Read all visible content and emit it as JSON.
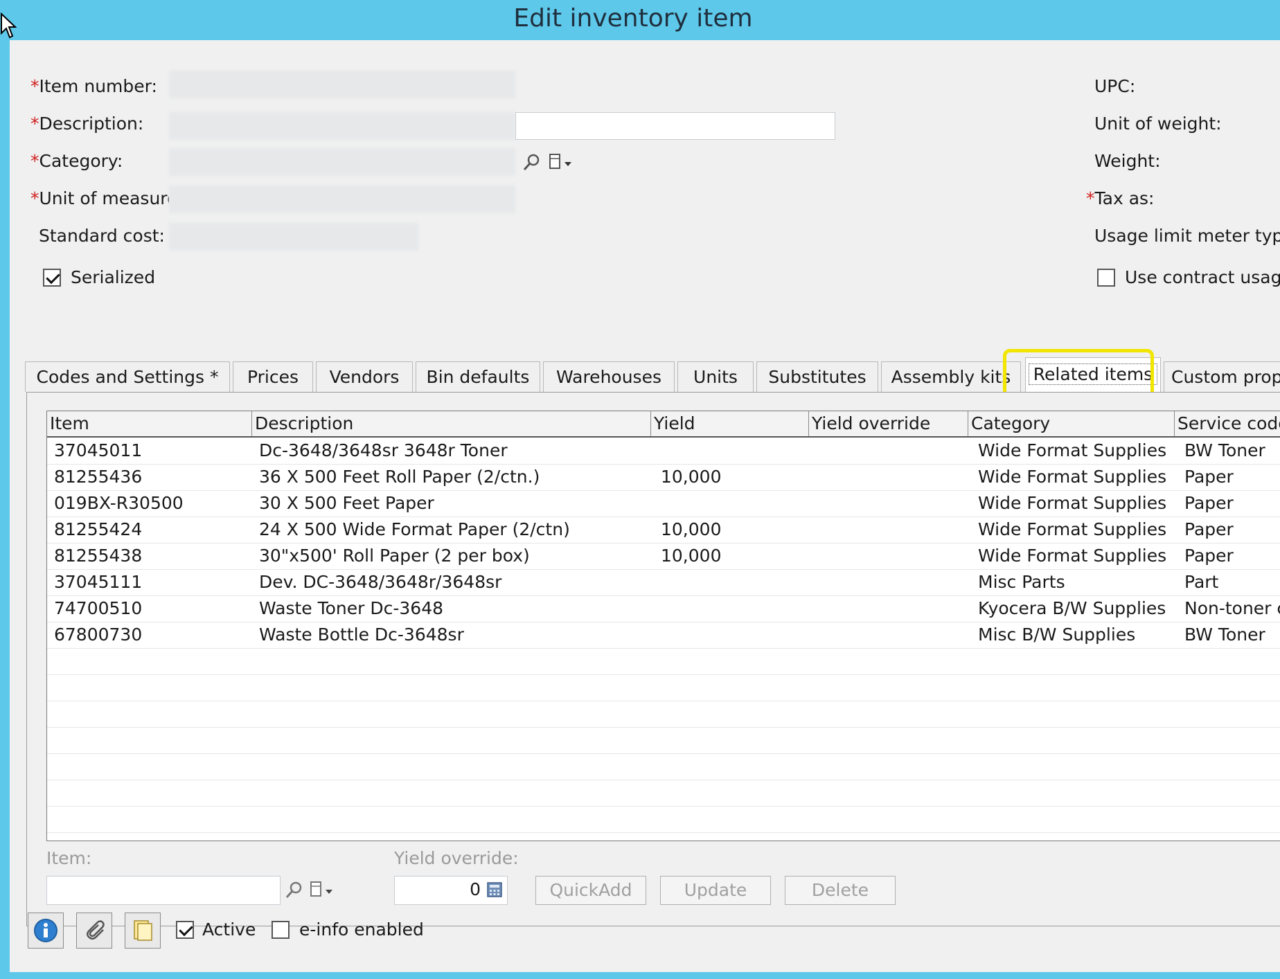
{
  "window": {
    "title": "Edit inventory item"
  },
  "form_left": {
    "item_number_label": "Item number:",
    "description_label": "Description:",
    "category_label": "Category:",
    "unit_of_measure_label": "Unit of measure",
    "standard_cost_label": "Standard cost:",
    "serialized_label": "Serialized",
    "serialized_checked": true
  },
  "form_right": {
    "upc_label": "UPC:",
    "unit_of_weight_label": "Unit of weight:",
    "weight_label": "Weight:",
    "tax_as_label": "Tax as:",
    "usage_limit_label": "Usage limit meter type:",
    "use_contract_label": "Use contract usage"
  },
  "required_marker": "*",
  "tabs": [
    {
      "label": "Codes and Settings  *"
    },
    {
      "label": "Prices"
    },
    {
      "label": "Vendors"
    },
    {
      "label": "Bin defaults"
    },
    {
      "label": "Warehouses"
    },
    {
      "label": "Units"
    },
    {
      "label": "Substitutes"
    },
    {
      "label": "Assembly kits"
    },
    {
      "label": "Related items",
      "active": true
    },
    {
      "label": "Custom properties"
    }
  ],
  "grid": {
    "columns": [
      "Item",
      "Description",
      "Yield",
      "Yield override",
      "Category",
      "Service code"
    ],
    "rows": [
      {
        "item": "37045011",
        "description": "Dc-3648/3648sr 3648r Toner",
        "yield": "",
        "yield_override": "",
        "category": "Wide Format Supplies",
        "service_code": "BW Toner"
      },
      {
        "item": "81255436",
        "description": "36 X 500 Feet Roll Paper (2/ctn.)",
        "yield": "10,000",
        "yield_override": "",
        "category": "Wide Format Supplies",
        "service_code": "Paper"
      },
      {
        "item": "019BX-R30500",
        "description": "30 X 500 Feet Paper",
        "yield": "",
        "yield_override": "",
        "category": "Wide Format Supplies",
        "service_code": "Paper"
      },
      {
        "item": "81255424",
        "description": "24 X 500 Wide Format Paper (2/ctn)",
        "yield": "10,000",
        "yield_override": "",
        "category": "Wide Format Supplies",
        "service_code": "Paper"
      },
      {
        "item": "81255438",
        "description": "30\"x500' Roll Paper (2 per box)",
        "yield": "10,000",
        "yield_override": "",
        "category": "Wide Format Supplies",
        "service_code": "Paper"
      },
      {
        "item": "37045111",
        "description": "Dev. DC-3648/3648r/3648sr",
        "yield": "",
        "yield_override": "",
        "category": "Misc Parts",
        "service_code": "Part"
      },
      {
        "item": "74700510",
        "description": "Waste Toner Dc-3648",
        "yield": "",
        "yield_override": "",
        "category": "Kyocera B/W Supplies",
        "service_code": "Non-toner c"
      },
      {
        "item": "67800730",
        "description": "Waste Bottle Dc-3648sr",
        "yield": "",
        "yield_override": "",
        "category": "Misc B/W Supplies",
        "service_code": "BW Toner"
      }
    ]
  },
  "editor": {
    "item_label": "Item:",
    "yield_override_label": "Yield override:",
    "yield_override_value": "0",
    "quickadd_label": "QuickAdd",
    "update_label": "Update",
    "delete_label": "Delete"
  },
  "footer": {
    "active_label": "Active",
    "active_checked": true,
    "einfo_label": "e-info enabled",
    "einfo_checked": false
  },
  "colors": {
    "title_bar": "#5ec8ea",
    "tab_highlight": "#f2e500",
    "required": "#d02020"
  }
}
